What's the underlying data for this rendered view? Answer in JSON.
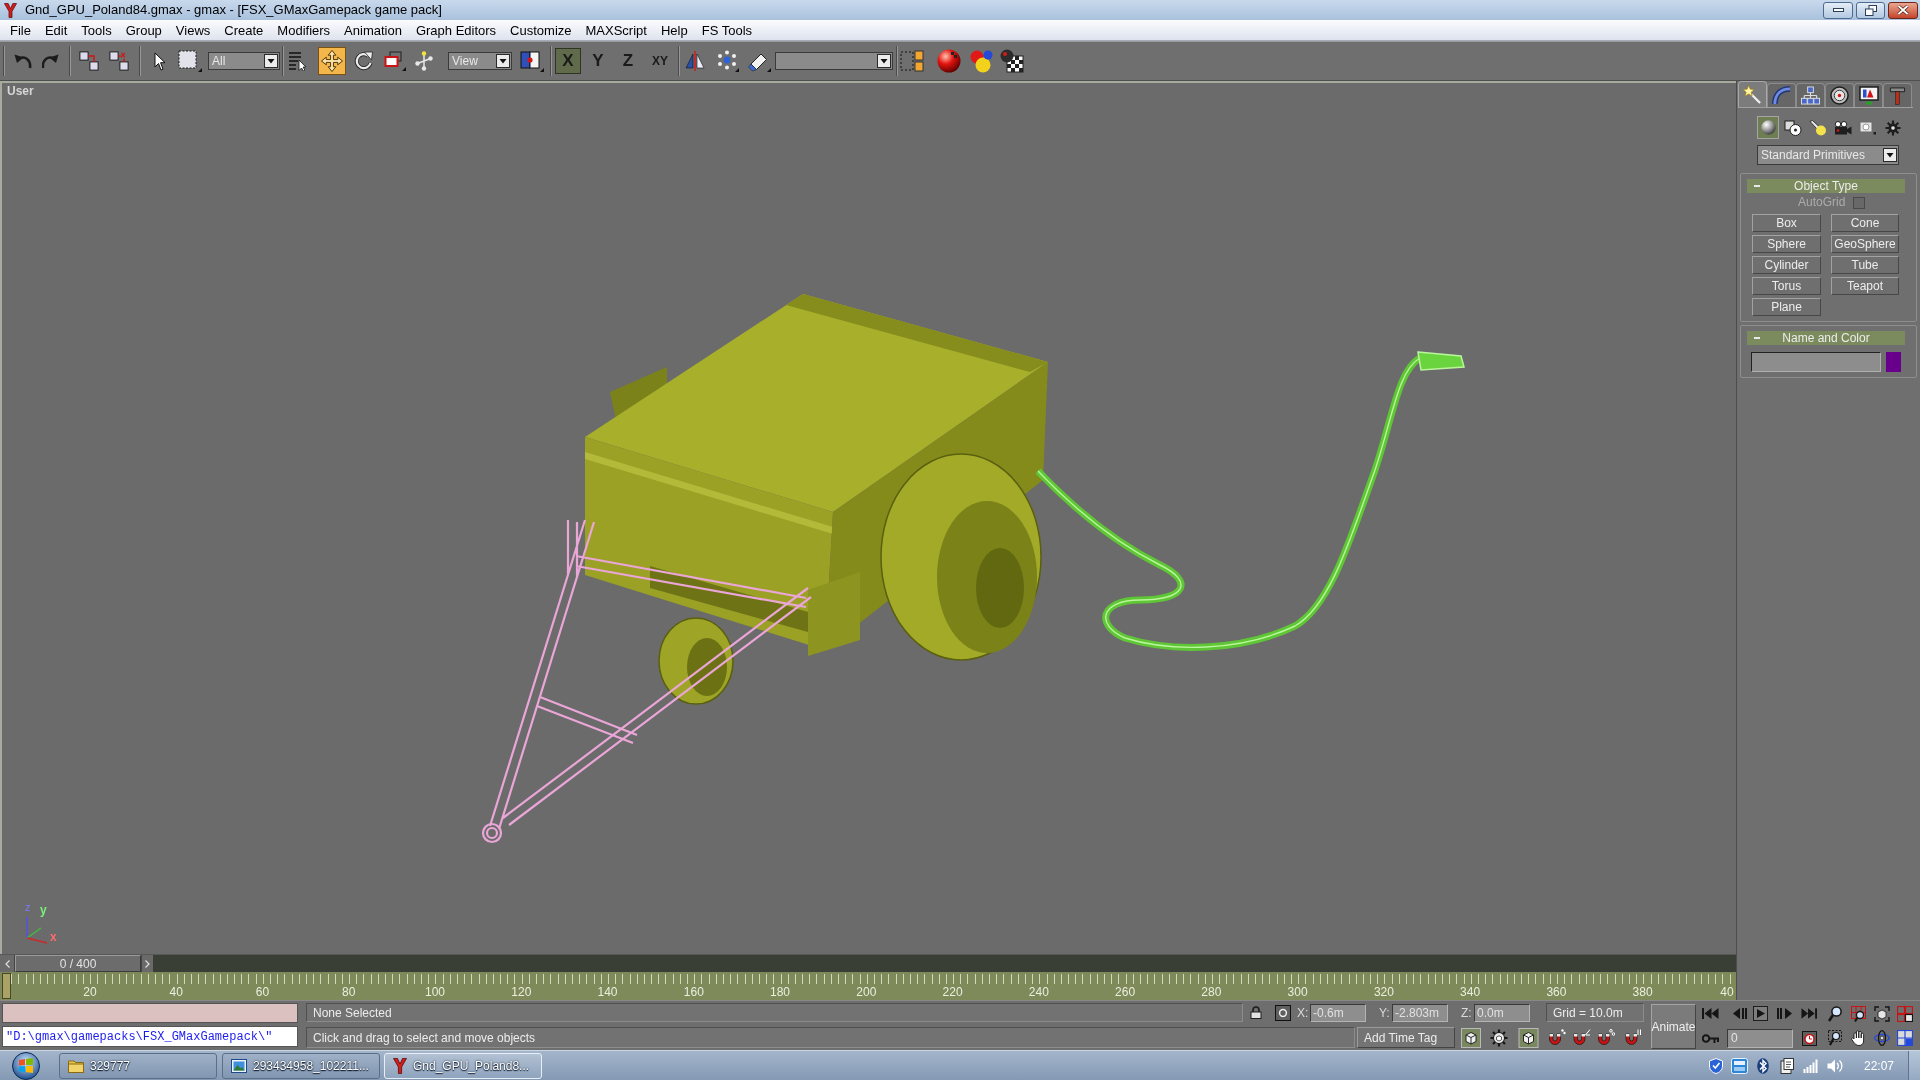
{
  "window": {
    "title": "Gnd_GPU_Poland84.gmax - gmax - [FSX_GMaxGamepack game pack]"
  },
  "menu": [
    "File",
    "Edit",
    "Tools",
    "Group",
    "Views",
    "Create",
    "Modifiers",
    "Animation",
    "Graph Editors",
    "Customize",
    "MAXScript",
    "Help",
    "FS Tools"
  ],
  "toolbar": {
    "tools": [
      {
        "selected": false
      },
      {
        "selected": true
      },
      {
        "selected": false
      },
      {
        "selected": false
      }
    ],
    "selection_filter": "All",
    "reference_coordinate_system": "View",
    "axis_constraints": [
      {
        "label": "X",
        "selected": true
      },
      {
        "label": "Y",
        "selected": false
      },
      {
        "label": "Z",
        "selected": false
      },
      {
        "label": "XY",
        "selected": false
      }
    ]
  },
  "viewport": {
    "label": "User",
    "axis_labels": [
      "z",
      "y",
      "x"
    ]
  },
  "timeline": {
    "slider_label": "0 / 400",
    "ruler_labels": [
      "20",
      "40",
      "60",
      "80",
      "100",
      "120",
      "140",
      "160",
      "180",
      "200",
      "220",
      "240",
      "260",
      "280",
      "300",
      "320",
      "340",
      "360",
      "380",
      "40"
    ]
  },
  "command_panel": {
    "tabs": [
      {
        "selected": true
      },
      {
        "selected": false
      },
      {
        "selected": false
      },
      {
        "selected": false
      },
      {
        "selected": false
      },
      {
        "selected": false
      }
    ],
    "categories": [
      {
        "selected": true
      },
      {
        "selected": false
      },
      {
        "selected": false
      },
      {
        "selected": false
      },
      {
        "selected": false
      },
      {
        "selected": false
      }
    ],
    "object_class": "Standard Primitives",
    "rollouts": [
      {
        "kind": "object_type",
        "title": "Object Type",
        "expanded": true,
        "autogrid": {
          "label": "AutoGrid",
          "checked": false,
          "disabled": true
        },
        "buttons": [
          "Box",
          "Cone",
          "Sphere",
          "GeoSphere",
          "Cylinder",
          "Tube",
          "Torus",
          "Teapot",
          "Plane"
        ]
      },
      {
        "kind": "name_color",
        "title": "Name and Color",
        "expanded": true,
        "color": "#68008c"
      }
    ]
  },
  "status_bar": {
    "listener_input": "\"D:\\gmax\\gamepacks\\FSX_GMaxGamepack\\\"",
    "prompt": "None Selected",
    "hint": "Click and drag to select and move objects",
    "coordinates": [
      {
        "axis": "X:",
        "value": "-0.6m"
      },
      {
        "axis": "Y:",
        "value": "-2.803m"
      },
      {
        "axis": "Z:",
        "value": "0.0m"
      }
    ],
    "grid": "Grid = 10.0m",
    "animate_button": "Animate",
    "time_tag_button": "Add Time Tag",
    "current_frame": "0"
  },
  "taskbar": {
    "tasks": [
      {
        "label": "329777",
        "selected": false
      },
      {
        "label": "293434958_102211...",
        "selected": false
      },
      {
        "label": "Gnd_GPU_Poland8...",
        "selected": true
      }
    ],
    "clock": "22:07"
  }
}
